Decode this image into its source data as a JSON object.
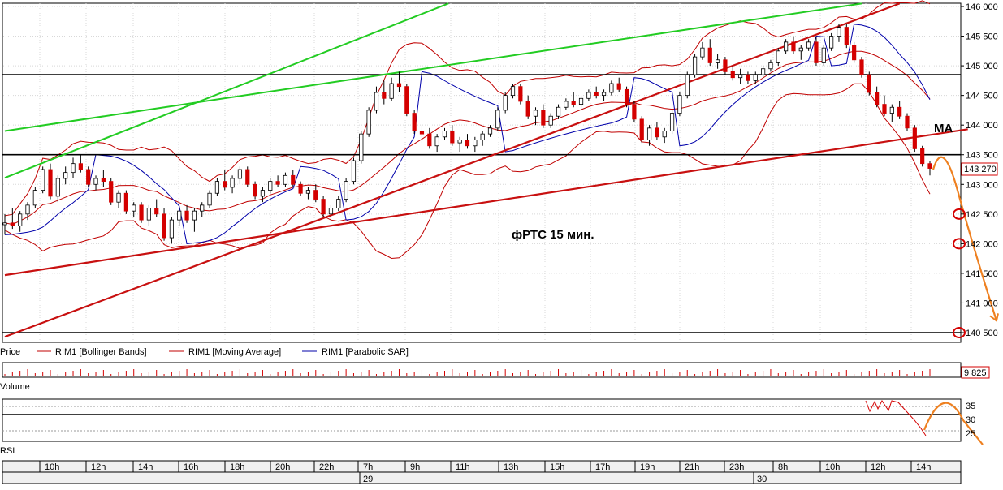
{
  "chart_data": {
    "type": "candlestick",
    "title": "фРТС   15 мин.",
    "ma_label": "MA",
    "y_axis": {
      "ticks": [
        "146 000",
        "145 500",
        "145 000",
        "144 500",
        "144 000",
        "143 500",
        "143 000",
        "142 500",
        "142 000",
        "141 500",
        "141 000",
        "140 500"
      ],
      "ylim": [
        140400,
        146050
      ]
    },
    "last_price": "143 270",
    "legend": [
      "Price",
      "RIM1 [Bollinger Bands]",
      "RIM1 [Moving Average]",
      "RIM1 [Parabolic SAR]"
    ],
    "volume_panel": {
      "label": "Volume",
      "value": "9 825"
    },
    "rsi_panel": {
      "label": "RSI",
      "ticks": [
        "35",
        "30",
        "25"
      ]
    },
    "time_axis": {
      "hours": [
        "10h",
        "12h",
        "14h",
        "16h",
        "18h",
        "20h",
        "22h",
        "7h",
        "9h",
        "11h",
        "13h",
        "15h",
        "17h",
        "19h",
        "21h",
        "23h",
        "8h",
        "10h",
        "12h",
        "14h"
      ],
      "days": [
        "29",
        "30"
      ]
    },
    "horizontal_levels": [
      144850,
      143500,
      140500
    ],
    "forecast_targets": [
      142500,
      142000,
      140500
    ],
    "colors": {
      "up": "#ffffff",
      "down": "#d40000",
      "bollinger": "#c00000",
      "moving_average": "#c00000",
      "sar": "#0000aa",
      "trend_red": "#c81010",
      "trend_green": "#22cc22",
      "forecast": "#ee8020"
    },
    "candles": [
      [
        142320,
        142500,
        142150,
        142350
      ],
      [
        142350,
        142600,
        142250,
        142300
      ],
      [
        142300,
        142550,
        142200,
        142500
      ],
      [
        142500,
        142700,
        142400,
        142650
      ],
      [
        142650,
        142950,
        142600,
        142900
      ],
      [
        142900,
        143300,
        142850,
        143250
      ],
      [
        143250,
        143350,
        142750,
        142800
      ],
      [
        142800,
        143150,
        142700,
        143100
      ],
      [
        143100,
        143300,
        143000,
        143200
      ],
      [
        143200,
        143450,
        143100,
        143350
      ],
      [
        143350,
        143500,
        143200,
        143250
      ],
      [
        143250,
        143300,
        142950,
        143000
      ],
      [
        143000,
        143150,
        142900,
        143100
      ],
      [
        143100,
        143250,
        142950,
        143050
      ],
      [
        143050,
        143100,
        142650,
        142700
      ],
      [
        142700,
        142900,
        142600,
        142850
      ],
      [
        142850,
        142900,
        142500,
        142550
      ],
      [
        142550,
        142700,
        142450,
        142650
      ],
      [
        142650,
        142700,
        142350,
        142400
      ],
      [
        142400,
        142650,
        142300,
        142600
      ],
      [
        142600,
        142750,
        142450,
        142500
      ],
      [
        142500,
        142600,
        142050,
        142100
      ],
      [
        142100,
        142450,
        142000,
        142400
      ],
      [
        142400,
        142600,
        142300,
        142550
      ],
      [
        142550,
        142650,
        142350,
        142400
      ],
      [
        142400,
        142600,
        142200,
        142550
      ],
      [
        142550,
        142700,
        142450,
        142650
      ],
      [
        142650,
        142900,
        142600,
        142850
      ],
      [
        142850,
        143100,
        142800,
        143050
      ],
      [
        143050,
        143250,
        142900,
        142950
      ],
      [
        142950,
        143150,
        142850,
        143100
      ],
      [
        143100,
        143300,
        143000,
        143250
      ],
      [
        143250,
        143300,
        142950,
        143000
      ],
      [
        143000,
        143050,
        142750,
        142800
      ],
      [
        142800,
        142950,
        142700,
        142900
      ],
      [
        142900,
        143100,
        142850,
        143050
      ],
      [
        143050,
        143150,
        142950,
        143000
      ],
      [
        143000,
        143200,
        142950,
        143150
      ],
      [
        143150,
        143250,
        142950,
        143000
      ],
      [
        143000,
        143050,
        142800,
        142850
      ],
      [
        142850,
        142950,
        142750,
        142900
      ],
      [
        142900,
        143000,
        142700,
        142750
      ],
      [
        142750,
        142800,
        142450,
        142500
      ],
      [
        142500,
        142650,
        142400,
        142600
      ],
      [
        142600,
        142800,
        142550,
        142750
      ],
      [
        142750,
        143100,
        142700,
        143050
      ],
      [
        143050,
        143450,
        143000,
        143400
      ],
      [
        143400,
        143900,
        143350,
        143850
      ],
      [
        143850,
        144300,
        143800,
        144250
      ],
      [
        144250,
        144650,
        144200,
        144550
      ],
      [
        144550,
        144750,
        144350,
        144450
      ],
      [
        144450,
        144800,
        144400,
        144700
      ],
      [
        144700,
        144900,
        144550,
        144650
      ],
      [
        144650,
        144700,
        144150,
        144200
      ],
      [
        144200,
        144250,
        143850,
        143900
      ],
      [
        143900,
        144000,
        143700,
        143850
      ],
      [
        143850,
        143950,
        143600,
        143650
      ],
      [
        143650,
        143850,
        143550,
        143800
      ],
      [
        143800,
        143950,
        143750,
        143900
      ],
      [
        143900,
        144000,
        143650,
        143700
      ],
      [
        143700,
        143800,
        143550,
        143750
      ],
      [
        143750,
        143850,
        143600,
        143650
      ],
      [
        143650,
        143800,
        143550,
        143750
      ],
      [
        143750,
        143900,
        143650,
        143850
      ],
      [
        143850,
        144000,
        143800,
        143950
      ],
      [
        143950,
        144300,
        143900,
        144250
      ],
      [
        144250,
        144550,
        144200,
        144500
      ],
      [
        144500,
        144700,
        144450,
        144650
      ],
      [
        144650,
        144700,
        144350,
        144400
      ],
      [
        144400,
        144500,
        144100,
        144150
      ],
      [
        144150,
        144300,
        144000,
        144250
      ],
      [
        144250,
        144350,
        143950,
        144000
      ],
      [
        144000,
        144200,
        143950,
        144150
      ],
      [
        144150,
        144350,
        144100,
        144300
      ],
      [
        144300,
        144450,
        144250,
        144400
      ],
      [
        144400,
        144550,
        144300,
        144350
      ],
      [
        144350,
        144500,
        144250,
        144450
      ],
      [
        144450,
        144600,
        144400,
        144550
      ],
      [
        144550,
        144650,
        144450,
        144500
      ],
      [
        144500,
        144600,
        144400,
        144550
      ],
      [
        144550,
        144750,
        144500,
        144700
      ],
      [
        144700,
        144800,
        144550,
        144600
      ],
      [
        144600,
        144650,
        144300,
        144350
      ],
      [
        144350,
        144400,
        144050,
        144100
      ],
      [
        144100,
        144150,
        143700,
        143750
      ],
      [
        143750,
        144000,
        143650,
        143950
      ],
      [
        143950,
        144050,
        143750,
        143800
      ],
      [
        143800,
        143950,
        143700,
        143900
      ],
      [
        143900,
        144250,
        143850,
        144200
      ],
      [
        144200,
        144550,
        144150,
        144500
      ],
      [
        144500,
        144900,
        144450,
        144850
      ],
      [
        144850,
        145200,
        144800,
        145150
      ],
      [
        145150,
        145400,
        145100,
        145300
      ],
      [
        145300,
        145450,
        145000,
        145050
      ],
      [
        145050,
        145200,
        144950,
        145100
      ],
      [
        145100,
        145150,
        144850,
        144900
      ],
      [
        144900,
        145000,
        144750,
        144800
      ],
      [
        144800,
        144950,
        144700,
        144850
      ],
      [
        144850,
        144900,
        144700,
        144750
      ],
      [
        144750,
        144900,
        144700,
        144850
      ],
      [
        144850,
        145000,
        144800,
        144950
      ],
      [
        144950,
        145100,
        144900,
        145050
      ],
      [
        145050,
        145300,
        145000,
        145250
      ],
      [
        145250,
        145450,
        145200,
        145400
      ],
      [
        145400,
        145500,
        145200,
        145250
      ],
      [
        145250,
        145350,
        145100,
        145300
      ],
      [
        145300,
        145450,
        145250,
        145400
      ],
      [
        145400,
        145500,
        145000,
        145050
      ],
      [
        145050,
        145350,
        145000,
        145300
      ],
      [
        145300,
        145550,
        145250,
        145500
      ],
      [
        145500,
        145700,
        145400,
        145650
      ],
      [
        145650,
        145700,
        145300,
        145350
      ],
      [
        145350,
        145400,
        145050,
        145100
      ],
      [
        145100,
        145150,
        144800,
        144850
      ],
      [
        144850,
        144900,
        144500,
        144550
      ],
      [
        144550,
        144650,
        144300,
        144350
      ],
      [
        144350,
        144500,
        144150,
        144200
      ],
      [
        144200,
        144350,
        144050,
        144300
      ],
      [
        144300,
        144400,
        144100,
        144150
      ],
      [
        144150,
        144200,
        143900,
        143950
      ],
      [
        143950,
        144000,
        143550,
        143600
      ],
      [
        143600,
        143650,
        143300,
        143350
      ],
      [
        143350,
        143400,
        143150,
        143270
      ]
    ]
  }
}
